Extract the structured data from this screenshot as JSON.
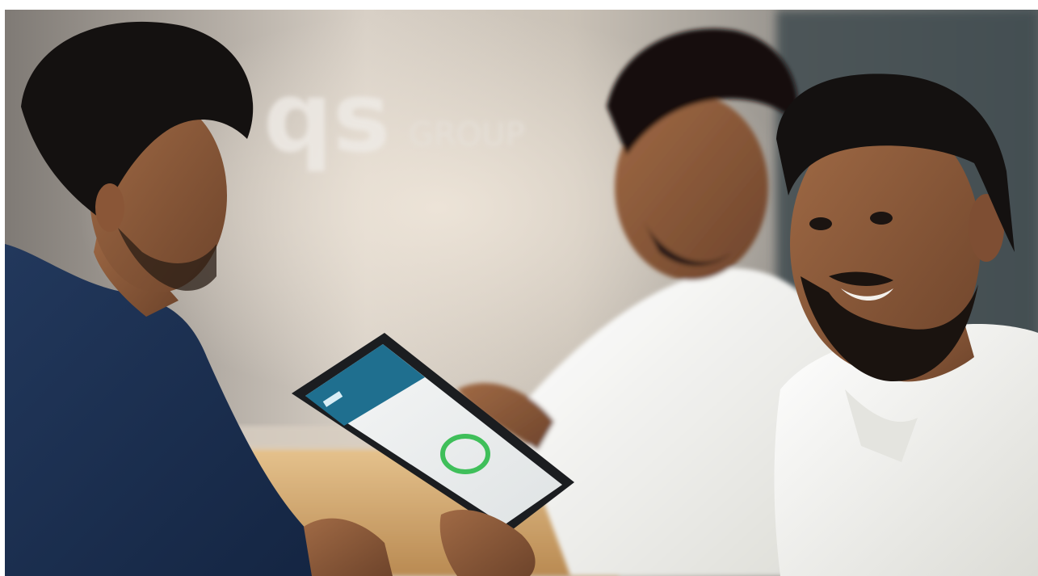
{
  "photo": {
    "background_logo_text": "qs",
    "background_logo_subtext": "GROUP",
    "tablet_screen_header_text": "",
    "colors": {
      "wall_warm": "#cfc6bb",
      "wall_cool": "#8a8985",
      "glass_panel": "#3e4a4f",
      "desk_wood": "#d6b27c",
      "navy_shirt": "#1c2f4e",
      "white_shirt": "#f2f2ee",
      "skin": "#8a5a3c",
      "hair": "#151210",
      "tablet_header": "#1f6f8f",
      "tablet_ring": "#3fbf5a"
    }
  }
}
